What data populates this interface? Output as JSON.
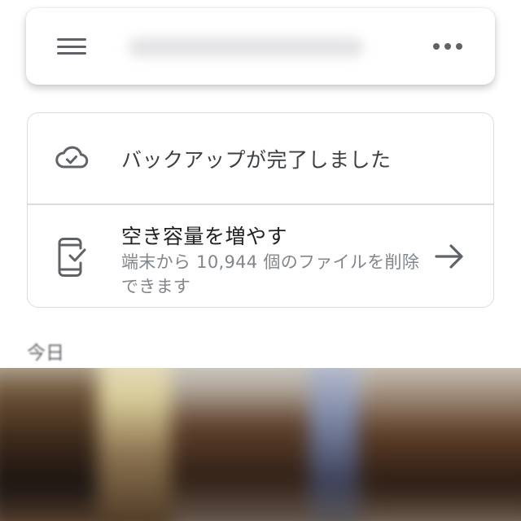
{
  "header": {
    "menu_icon": "hamburger-menu-icon",
    "more_icon": "more-horizontal-icon"
  },
  "status_card": {
    "backup": {
      "icon": "cloud-done-icon",
      "text": "バックアップが完了しました"
    },
    "free_space": {
      "icon": "phone-check-icon",
      "title": "空き容量を増やす",
      "subtitle": "端末から 10,944 個のファイルを削除できます",
      "arrow_icon": "arrow-right-icon"
    }
  },
  "section": {
    "title": "今日"
  },
  "colors": {
    "icon": "#5f6368",
    "divider": "#dadce0",
    "secondary_text": "#80868b"
  }
}
